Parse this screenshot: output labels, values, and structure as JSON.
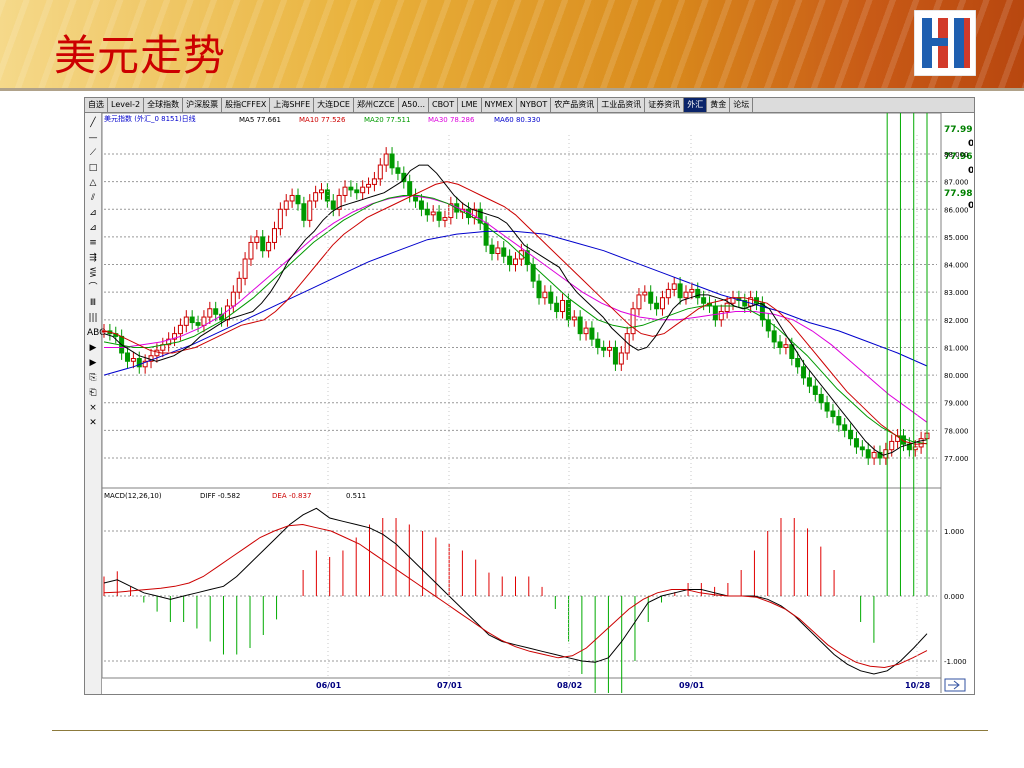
{
  "slide": {
    "title": "美元走势"
  },
  "tabs": [
    "自选",
    "Level-2",
    "全球指数",
    "沪深股票",
    "股指CFFEX",
    "上海SHFE",
    "大连DCE",
    "郑州CZCE",
    "A50...",
    "CBOT",
    "LME",
    "NYMEX",
    "NYBOT",
    "农产品资讯",
    "工业品资讯",
    "证券资讯",
    "外汇",
    "黄金",
    "论坛"
  ],
  "active_tab": 16,
  "tools": [
    "╱",
    "—",
    "⟋",
    "□",
    "△",
    "⫽",
    "⊿",
    "⊿",
    "≡",
    "⇶",
    "⋚",
    "⌒",
    "Ⅲ",
    "|||",
    "ABC",
    "▶",
    "▶",
    "⎘",
    "⎗",
    "×",
    "✕"
  ],
  "main_panel": {
    "instrument": "美元指数 (外汇_0 8151)日线",
    "ma": [
      {
        "label": "MA5 77.661",
        "color": "#000000"
      },
      {
        "label": "MA10 77.526",
        "color": "#cc0000"
      },
      {
        "label": "MA20 77.511",
        "color": "#009900"
      },
      {
        "label": "MA30 78.286",
        "color": "#dd00dd"
      },
      {
        "label": "MA60  80.330",
        "color": "#0000cc"
      }
    ],
    "right_values": [
      {
        "text": "77.993",
        "color": "#008000"
      },
      {
        "text": "0",
        "color": "#000000"
      },
      {
        "text": "77.966",
        "color": "#008000"
      },
      {
        "text": "0",
        "color": "#000000"
      },
      {
        "text": "77.980",
        "color": "#008000"
      },
      {
        "text": "0",
        "color": "#000000"
      }
    ],
    "y_labels": [
      "88.000",
      "87.000",
      "86.000",
      "85.000",
      "84.000",
      "83.000",
      "82.000",
      "81.000",
      "80.000",
      "79.000",
      "78.000",
      "77.000"
    ]
  },
  "macd_panel": {
    "label": "MACD(12,26,10)",
    "diff": "DIFF  -0.582",
    "dea": "DEA  -0.837",
    "macd": "0.511",
    "y_labels": [
      "1.000",
      "0.000",
      "-1.000"
    ]
  },
  "x_labels": [
    "06/01",
    "07/01",
    "08/02",
    "09/01",
    "10/28"
  ],
  "chart_data": {
    "type": "candlestick",
    "title": "美元指数 (外汇_0 8151)日线",
    "y_range": [
      77,
      88
    ],
    "x_ticks": [
      "06/01",
      "07/01",
      "08/02",
      "09/01",
      "10/28"
    ],
    "close": [
      81.6,
      81.5,
      81.4,
      80.8,
      80.5,
      80.6,
      80.3,
      80.5,
      80.7,
      80.9,
      81.1,
      81.3,
      81.5,
      81.8,
      82.1,
      81.9,
      81.8,
      82.1,
      82.4,
      82.2,
      82.0,
      82.5,
      83.0,
      83.5,
      84.2,
      84.8,
      85.0,
      84.5,
      84.8,
      85.3,
      86.0,
      86.3,
      86.5,
      86.2,
      85.6,
      86.3,
      86.6,
      86.7,
      86.3,
      86.0,
      86.5,
      86.8,
      86.7,
      86.6,
      86.8,
      86.9,
      87.1,
      87.6,
      88.0,
      87.5,
      87.3,
      87.0,
      86.5,
      86.3,
      86.0,
      85.8,
      85.9,
      85.6,
      85.7,
      86.2,
      85.9,
      86.0,
      85.7,
      86.0,
      85.5,
      84.7,
      84.4,
      84.6,
      84.3,
      84.0,
      84.2,
      84.5,
      84.0,
      83.4,
      82.8,
      83.0,
      82.6,
      82.3,
      82.7,
      82.0,
      82.1,
      81.5,
      81.7,
      81.3,
      81.0,
      80.9,
      81.0,
      80.4,
      80.8,
      81.5,
      82.4,
      82.9,
      83.0,
      82.6,
      82.4,
      82.8,
      83.1,
      83.3,
      82.8,
      83.0,
      83.1,
      82.8,
      82.6,
      82.5,
      82.0,
      82.3,
      82.6,
      82.8,
      82.7,
      82.5,
      82.8,
      82.6,
      82.0,
      81.6,
      81.2,
      81.0,
      81.1,
      80.6,
      80.3,
      79.9,
      79.6,
      79.3,
      79.0,
      78.7,
      78.5,
      78.2,
      78.0,
      77.7,
      77.4,
      77.3,
      77.0,
      77.2,
      77.0,
      77.3,
      77.6,
      77.8,
      77.5,
      77.3,
      77.4,
      77.7,
      77.9
    ],
    "ma5": [
      81.5,
      81.4,
      81.1,
      80.9,
      80.7,
      80.6,
      80.5,
      80.6,
      80.7,
      80.9,
      81.1,
      81.4,
      81.6,
      81.8,
      82.0,
      82.1,
      82.2,
      82.3,
      82.6,
      83.0,
      83.5,
      84.1,
      84.5,
      84.9,
      85.2,
      85.6,
      85.9,
      86.1,
      86.2,
      86.3,
      86.4,
      86.5,
      86.6,
      86.8,
      87.0,
      87.4,
      87.6,
      87.6,
      87.3,
      86.9,
      86.5,
      86.2,
      86.0,
      85.9,
      85.8,
      85.7,
      85.5,
      85.1,
      84.7,
      84.5,
      84.3,
      84.1,
      83.9,
      83.4,
      83.0,
      82.7,
      82.4,
      82.1,
      81.7,
      81.4,
      81.1,
      80.9,
      81.0,
      81.4,
      81.9,
      82.4,
      82.7,
      82.8,
      82.9,
      82.9,
      82.8,
      82.7,
      82.5,
      82.4,
      82.5,
      82.6,
      82.4,
      81.9,
      81.4,
      80.9,
      80.4,
      80.0,
      79.6,
      79.2,
      78.8,
      78.4,
      78.0,
      77.6,
      77.3,
      77.1,
      77.2,
      77.4,
      77.5,
      77.6,
      77.66
    ],
    "ma10": [
      81.6,
      81.5,
      81.3,
      81.1,
      80.9,
      80.8,
      80.8,
      80.9,
      81.0,
      81.2,
      81.4,
      81.6,
      81.8,
      81.9,
      82.0,
      82.3,
      82.7,
      83.2,
      83.7,
      84.2,
      84.7,
      85.1,
      85.4,
      85.7,
      85.9,
      86.1,
      86.3,
      86.5,
      86.7,
      86.9,
      87.0,
      86.9,
      86.7,
      86.5,
      86.3,
      86.1,
      85.8,
      85.4,
      85.0,
      84.6,
      84.2,
      83.8,
      83.4,
      83.0,
      82.6,
      82.2,
      81.8,
      81.5,
      81.4,
      81.5,
      81.8,
      82.1,
      82.4,
      82.6,
      82.7,
      82.8,
      82.8,
      82.7,
      82.6,
      82.3,
      81.9,
      81.4,
      80.9,
      80.4,
      79.9,
      79.4,
      79.0,
      78.6,
      78.2,
      77.9,
      77.6,
      77.5,
      77.53
    ],
    "ma20": [
      81.2,
      81.1,
      81.0,
      81.0,
      81.1,
      81.2,
      81.4,
      81.7,
      82.0,
      82.4,
      82.8,
      83.3,
      83.8,
      84.3,
      84.8,
      85.2,
      85.6,
      85.9,
      86.2,
      86.4,
      86.5,
      86.5,
      86.4,
      86.2,
      85.9,
      85.6,
      85.2,
      84.8,
      84.3,
      83.8,
      83.3,
      82.8,
      82.4,
      82.0,
      81.8,
      81.7,
      81.8,
      82.0,
      82.2,
      82.4,
      82.5,
      82.5,
      82.5,
      82.4,
      82.1,
      81.7,
      81.2,
      80.7,
      80.1,
      79.5,
      79.0,
      78.5,
      78.1,
      77.8,
      77.6,
      77.51
    ],
    "ma30": [
      81.0,
      81.0,
      81.1,
      81.2,
      81.4,
      81.7,
      82.1,
      82.6,
      83.2,
      83.8,
      84.4,
      85.0,
      85.5,
      85.9,
      86.2,
      86.4,
      86.5,
      86.4,
      86.2,
      85.9,
      85.5,
      85.0,
      84.5,
      84.0,
      83.5,
      83.0,
      82.6,
      82.3,
      82.1,
      82.0,
      82.0,
      82.1,
      82.2,
      82.3,
      82.3,
      82.2,
      82.0,
      81.6,
      81.1,
      80.5,
      79.9,
      79.3,
      78.8,
      78.29
    ],
    "ma60": [
      80.0,
      80.3,
      80.7,
      81.1,
      81.6,
      82.1,
      82.6,
      83.1,
      83.6,
      84.1,
      84.5,
      84.9,
      85.1,
      85.2,
      85.2,
      85.1,
      84.8,
      84.5,
      84.1,
      83.7,
      83.3,
      82.9,
      82.6,
      82.3,
      81.9,
      81.6,
      81.2,
      80.8,
      80.33
    ],
    "macd_diff": [
      0.2,
      0.25,
      0.15,
      0.05,
      0.0,
      -0.05,
      0.0,
      0.05,
      0.1,
      0.15,
      0.3,
      0.5,
      0.7,
      0.9,
      1.1,
      1.25,
      1.35,
      1.2,
      1.15,
      1.1,
      1.05,
      0.95,
      0.8,
      0.6,
      0.4,
      0.2,
      0.0,
      -0.2,
      -0.4,
      -0.6,
      -0.7,
      -0.75,
      -0.8,
      -0.85,
      -0.9,
      -0.95,
      -1.0,
      -1.02,
      -0.95,
      -0.7,
      -0.4,
      -0.1,
      0.0,
      0.05,
      0.1,
      0.1,
      0.05,
      0.0,
      0.0,
      0.0,
      -0.05,
      -0.15,
      -0.3,
      -0.5,
      -0.7,
      -0.9,
      -1.05,
      -1.15,
      -1.2,
      -1.15,
      -1.0,
      -0.8,
      -0.58
    ],
    "macd_dea": [
      0.05,
      0.06,
      0.08,
      0.1,
      0.12,
      0.15,
      0.2,
      0.3,
      0.45,
      0.6,
      0.75,
      0.9,
      1.0,
      1.08,
      1.1,
      1.05,
      1.0,
      0.9,
      0.8,
      0.65,
      0.5,
      0.35,
      0.2,
      0.05,
      -0.1,
      -0.25,
      -0.4,
      -0.55,
      -0.68,
      -0.78,
      -0.85,
      -0.9,
      -0.95,
      -0.92,
      -0.8,
      -0.6,
      -0.4,
      -0.2,
      -0.05,
      0.05,
      0.1,
      0.1,
      0.05,
      0.02,
      0.0,
      0.0,
      -0.02,
      -0.1,
      -0.2,
      -0.35,
      -0.55,
      -0.75,
      -0.9,
      -1.02,
      -1.08,
      -1.1,
      -1.05,
      -0.95,
      -0.84
    ]
  }
}
